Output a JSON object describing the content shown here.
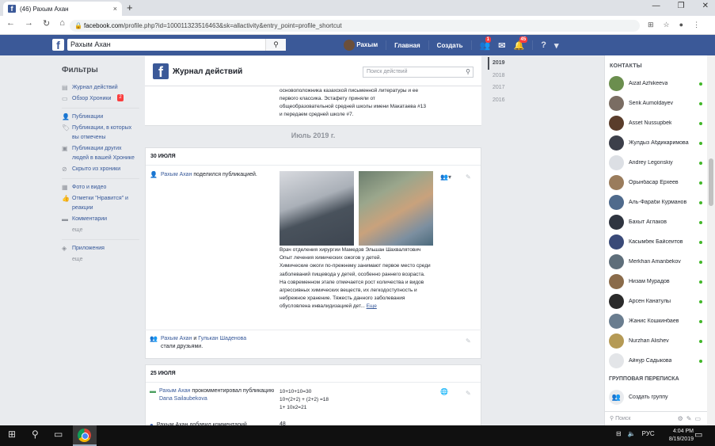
{
  "browser": {
    "tab_title": "(46) Рахым Ахан",
    "tab_close": "×",
    "new_tab": "+",
    "url_host": "facebook.com",
    "url_path": "/profile.php?id=100011323516463&sk=allactivity&entry_point=profile_shortcut",
    "win_min": "—",
    "win_max": "❐",
    "win_close": "✕"
  },
  "fb": {
    "logo": "f",
    "search_value": "Рахым Ахан",
    "user_name": "Рахым",
    "home": "Главная",
    "create": "Создать",
    "friends_badge": "1",
    "notif_badge": "45",
    "help": "?"
  },
  "filters": {
    "title": "Фильтры",
    "items": [
      {
        "icon": "journal-icon",
        "label": "Журнал действий"
      },
      {
        "icon": "timeline-icon",
        "label": "Обзор Хроники",
        "badge": "2"
      }
    ],
    "group2": [
      {
        "icon": "person-icon",
        "label": "Публикации"
      },
      {
        "icon": "tag-icon",
        "label": "Публикации, в которых вы отмечены"
      },
      {
        "icon": "posts-others-icon",
        "label": "Публикации других людей в вашей Хронике"
      },
      {
        "icon": "hidden-icon",
        "label": "Скрыто из хроники"
      }
    ],
    "group3": [
      {
        "icon": "photo-icon",
        "label": "Фото и видео"
      },
      {
        "icon": "like-icon",
        "label": "Отметки \"Нравится\" и реакции"
      },
      {
        "icon": "comment-icon",
        "label": "Комментарии"
      }
    ],
    "more": "еще",
    "group4": [
      {
        "icon": "apps-icon",
        "label": "Приложения"
      }
    ]
  },
  "log": {
    "title": "Журнал действий",
    "search_placeholder": "Поиск действий",
    "prev_text": "основоположника казахской письменной литературы и ее первого классика. Эстафету приняли от общеобразовательной средней школы имени Макатаева #13 и передаем средней школе #7.",
    "month_sep": "Июль 2019 г.",
    "sections": [
      {
        "date": "30 ИЮЛЯ",
        "share_actor": "Рахым Ахан",
        "share_action": "поделился публикацией.",
        "post_text": "Врач отделения хирургии Мамедов Эльшан Шахвалятович\nОпыт лечения химических ожогов у детей.\nХимические ожоги по-прежнему занимают первое место среди заболеваний пищевода у детей, особенно раннего возраста. На современном этапе отмечается рост количества и видов агрессивных химических веществ, их легкодоступность и небрежное хранение. Тяжесть данного заболевания обусловлена инвалидизацией дет...",
        "post_more": "Еще",
        "friends_actor": "Рахым Ахан",
        "friends_and": "и",
        "friends_other": "Гулькан Шаденова",
        "friends_action": "стали друзьями."
      },
      {
        "date": "25 ИЮЛЯ",
        "comment_actor": "Рахым Ахан",
        "comment_action": "прокомментировал публикацию",
        "comment_target": "Dana Sailaubekova",
        "comment_text": "10+10+10=30\n10+(2+2) + (2+2) =18\n1+ 10х2=21",
        "next_row": "Рахым Ахан добавил комментарий",
        "next_value": "48"
      }
    ]
  },
  "years": [
    "2019",
    "2018",
    "2017",
    "2016"
  ],
  "chat": {
    "title": "КОНТАКТЫ",
    "contacts": [
      {
        "name": "Aizat Azhikeeva",
        "color": "#6b8e4e"
      },
      {
        "name": "Serik Aumoldayev",
        "color": "#7a6d63"
      },
      {
        "name": "Asset Nussupbek",
        "color": "#5a3d2b"
      },
      {
        "name": "Жулдыз Абдикаримова",
        "color": "#3c3f4a"
      },
      {
        "name": "Andrey Legonskiy",
        "color": "#dcdfe4"
      },
      {
        "name": "Орынбасар Ерхеев",
        "color": "#9a7c5c"
      },
      {
        "name": "Аль-Фараби Курманов",
        "color": "#4f6a8c"
      },
      {
        "name": "Бахыт Аглаков",
        "color": "#2f3540"
      },
      {
        "name": "Касымбек Байсеитов",
        "color": "#3a4a78"
      },
      {
        "name": "Merkhan Amanbekov",
        "color": "#5e6e7a"
      },
      {
        "name": "Низам Мурадов",
        "color": "#8a6b4a"
      },
      {
        "name": "Арсен Канатулы",
        "color": "#2b2b2b"
      },
      {
        "name": "Жанис Кошкинбаев",
        "color": "#6a7d8f"
      },
      {
        "name": "Nurzhan Alishev",
        "color": "#b59a55"
      },
      {
        "name": "Айнур Садыкова",
        "color": "#e3e5e8"
      }
    ],
    "group_title": "ГРУППОВАЯ ПЕРЕПИСКА",
    "create_group": "Создать группу",
    "search_placeholder": "Поиск"
  },
  "taskbar": {
    "time": "4:04 PM",
    "date": "8/19/2019",
    "lang": "РУС"
  }
}
